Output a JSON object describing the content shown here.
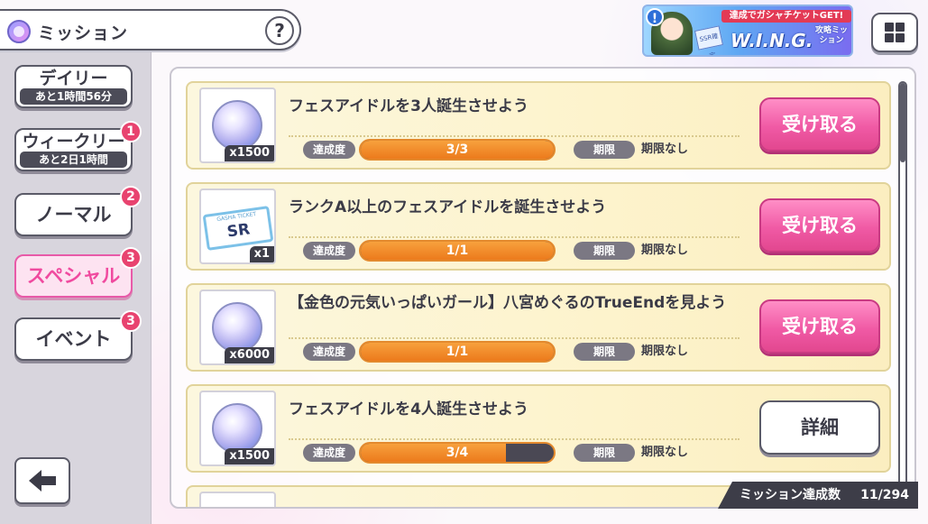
{
  "header": {
    "title": "ミッション",
    "help_label": "?"
  },
  "banner": {
    "alert": "!",
    "top_text": "達成でガシャチケットGET!",
    "main_text": "W.I.N.G.",
    "sub_text": "攻略ミッション",
    "ticket_text": "SSR確定"
  },
  "sidebar": {
    "tabs": [
      {
        "label": "デイリー",
        "sub": "あと1時間56分",
        "badge": ""
      },
      {
        "label": "ウィークリー",
        "sub": "あと2日1時間",
        "badge": "1"
      },
      {
        "label": "ノーマル",
        "sub": "",
        "badge": "2"
      },
      {
        "label": "スペシャル",
        "sub": "",
        "badge": "3",
        "active": true
      },
      {
        "label": "イベント",
        "sub": "",
        "badge": "3"
      }
    ]
  },
  "common": {
    "progress_label": "達成度",
    "deadline_label": "期限"
  },
  "missions": [
    {
      "title": "フェスアイドルを3人誕生させよう",
      "reward_qty": "x1500",
      "reward_icon": "gem-icon",
      "progress_text": "3/3",
      "progress": 1.0,
      "deadline": "期限なし",
      "action": "受け取る"
    },
    {
      "title": "ランクA以上のフェスアイドルを誕生させよう",
      "reward_qty": "x1",
      "reward_icon": "ticket-icon",
      "ticket_small": "GASHA TICKET",
      "ticket_main": "SR",
      "progress_text": "1/1",
      "progress": 1.0,
      "deadline": "期限なし",
      "action": "受け取る"
    },
    {
      "title": "【金色の元気いっぱいガール】八宮めぐるのTrueEndを見よう",
      "reward_qty": "x6000",
      "reward_icon": "gem-icon",
      "progress_text": "1/1",
      "progress": 1.0,
      "deadline": "期限なし",
      "action": "受け取る"
    },
    {
      "title": "フェスアイドルを4人誕生させよう",
      "reward_qty": "x1500",
      "reward_icon": "gem-icon",
      "progress_text": "3/4",
      "progress": 0.75,
      "deadline": "期限なし",
      "action": "詳細"
    }
  ],
  "footer": {
    "count_label": "ミッション達成数",
    "count_value": "11/294"
  },
  "colors": {
    "accent_pink": "#f05aa5",
    "progress_orange": "#ec7a1c",
    "badge_red": "#e8436f"
  }
}
